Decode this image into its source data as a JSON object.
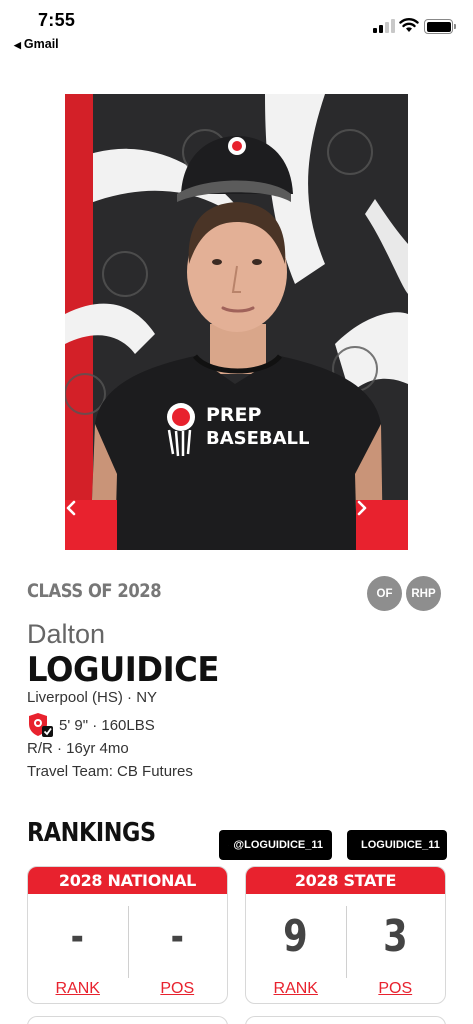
{
  "status_bar": {
    "time": "7:55",
    "back_app": "Gmail",
    "battery_level": 1.0
  },
  "photo": {
    "prev_icon": "chevron-left-icon",
    "next_icon": "chevron-right-icon",
    "shirt_text_line1": "PREP",
    "shirt_text_line2": "BASEBALL",
    "backdrop_text": "PREP BASEBALL"
  },
  "profile": {
    "class_of": "CLASS OF 2028",
    "positions": [
      "OF",
      "RHP"
    ],
    "first_name": "Dalton",
    "last_name": "LOGUIDICE",
    "school": "Liverpool (HS) · NY",
    "measurements": "5' 9\" · 160LBS",
    "bats_throws_age": "R/R · 16yr 4mo",
    "travel_team": "Travel Team: CB Futures"
  },
  "rankings": {
    "title": "RANKINGS",
    "social_x": "@LOGUIDICE_11",
    "social_ig": "LOGUIDICE_11",
    "national": {
      "header": "2028 NATIONAL",
      "rank_value": "-",
      "pos_value": "-",
      "rank_label": "RANK",
      "pos_label": "POS"
    },
    "state": {
      "header": "2028 STATE",
      "rank_value": "9",
      "pos_value": "3",
      "rank_label": "RANK",
      "pos_label": "POS"
    }
  },
  "colors": {
    "accent": "#e8222e",
    "badge": "#8e8e8e",
    "social_bg": "#000000"
  }
}
